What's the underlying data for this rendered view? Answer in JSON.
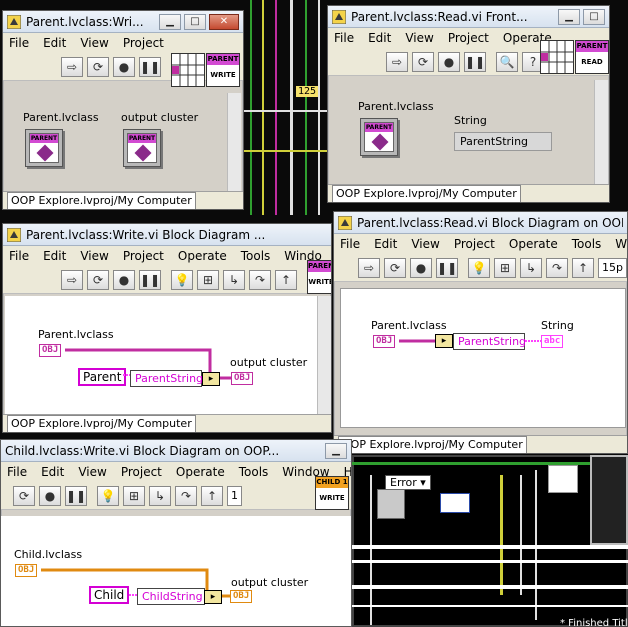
{
  "background": {
    "num_label": "125",
    "error_case": "Error",
    "finished_label": "* Finished Titles"
  },
  "win1": {
    "title": "Parent.lvclass:Wri...",
    "menu": [
      "File",
      "Edit",
      "View",
      "Project"
    ],
    "connector_icon": {
      "band": "PARENT",
      "sub": "WRITE"
    },
    "controls": [
      {
        "label": "Parent.lvclass",
        "band": "PARENT"
      },
      {
        "label": "output cluster",
        "band": "PARENT"
      }
    ],
    "status": "OOP Explore.lvproj/My Computer"
  },
  "win2": {
    "title": "Parent.lvclass:Read.vi Front...",
    "menu": [
      "File",
      "Edit",
      "View",
      "Project",
      "Operate"
    ],
    "connector_icon": {
      "band": "PARENT",
      "sub": "READ"
    },
    "control": {
      "label": "Parent.lvclass",
      "band": "PARENT"
    },
    "indicator": {
      "label": "String",
      "value": "ParentString"
    },
    "status": "OOP Explore.lvproj/My Computer"
  },
  "win3": {
    "title": "Parent.lvclass:Write.vi Block Diagram ...",
    "menu": [
      "File",
      "Edit",
      "View",
      "Project",
      "Operate",
      "Tools",
      "Windo"
    ],
    "connector_icon": {
      "band": "PARENT",
      "sub": "WRITE"
    },
    "input_label": "Parent.lvclass",
    "obj_term": "OBJ",
    "const_value": "Parent",
    "bundle_field": "ParentString",
    "output_label": "output cluster",
    "out_term": "OBJ",
    "status": "OOP Explore.lvproj/My Computer"
  },
  "win4": {
    "title": "Parent.lvclass:Read.vi Block Diagram on OOP Exp...",
    "menu": [
      "File",
      "Edit",
      "View",
      "Project",
      "Operate",
      "Tools",
      "Windo"
    ],
    "font_size": "15p",
    "input_label": "Parent.lvclass",
    "obj_term": "OBJ",
    "unbundle_field": "ParentString",
    "output_label": "String",
    "out_term": "abc",
    "status": "OOP Explore.lvproj/My Computer"
  },
  "win5": {
    "title": "Child.lvclass:Write.vi Block Diagram on OOP...",
    "menu": [
      "File",
      "Edit",
      "View",
      "Project",
      "Operate",
      "Tools",
      "Window",
      "H"
    ],
    "font_size": "1",
    "connector_icon": {
      "band": "CHILD 1",
      "sub": "WRITE"
    },
    "input_label": "Child.lvclass",
    "obj_term": "OBJ",
    "const_value": "Child",
    "bundle_field": "ChildString",
    "output_label": "output cluster",
    "out_term": "OBJ"
  },
  "colors": {
    "parent_wire": "#c02da0",
    "child_wire": "#e08a10",
    "string_wire": "#ff40ff"
  }
}
